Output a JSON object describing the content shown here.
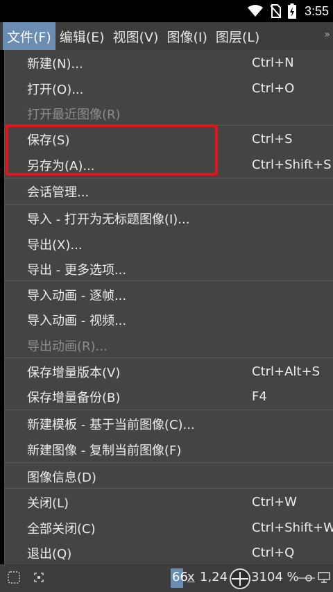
{
  "status_bar": {
    "time": "3:55"
  },
  "menubar": {
    "items": [
      {
        "label": "文件(F)"
      },
      {
        "label": "编辑(E)"
      },
      {
        "label": "视图(V)"
      },
      {
        "label": "图像(I)"
      },
      {
        "label": "图层(L)"
      }
    ],
    "more": "»"
  },
  "file_menu": {
    "items": [
      {
        "label": "新建(N)...",
        "shortcut": "Ctrl+N"
      },
      {
        "label": "打开(O)...",
        "shortcut": "Ctrl+O"
      },
      {
        "label": "打开最近图像(R)",
        "shortcut": ""
      },
      {
        "label": "保存(S)",
        "shortcut": "Ctrl+S"
      },
      {
        "label": "另存为(A)...",
        "shortcut": "Ctrl+Shift+S"
      },
      {
        "label": "会话管理...",
        "shortcut": ""
      },
      {
        "label": "导入 - 打开为无标题图像(I)...",
        "shortcut": ""
      },
      {
        "label": "导出(X)...",
        "shortcut": ""
      },
      {
        "label": "导出 - 更多选项...",
        "shortcut": ""
      },
      {
        "label": "导入动画 - 逐帧...",
        "shortcut": ""
      },
      {
        "label": "导入动画 - 视频...",
        "shortcut": ""
      },
      {
        "label": "导出动画(R)...",
        "shortcut": ""
      },
      {
        "label": "保存增量版本(V)",
        "shortcut": "Ctrl+Alt+S"
      },
      {
        "label": "保存增量备份(B)",
        "shortcut": "F4"
      },
      {
        "label": "新建模板 - 基于当前图像(C)...",
        "shortcut": ""
      },
      {
        "label": "新建图像 - 复制当前图像(F)",
        "shortcut": ""
      },
      {
        "label": "图像信息(D)",
        "shortcut": ""
      },
      {
        "label": "关闭(L)",
        "shortcut": "Ctrl+W"
      },
      {
        "label": "全部关闭(C)",
        "shortcut": "Ctrl+Shift+W"
      },
      {
        "label": "退出(Q)",
        "shortcut": "Ctrl+Q"
      }
    ]
  },
  "bottom_bar": {
    "size_left": "66",
    "size_x": "x",
    "size_right": "1,24",
    "zoom": "3104 %"
  },
  "colors": {
    "highlight": "#e0141a",
    "active_menu": "#6a8db4",
    "menu_bg": "#444444"
  }
}
